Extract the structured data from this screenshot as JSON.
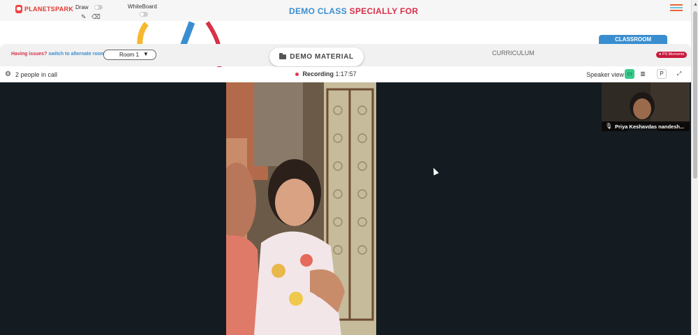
{
  "header": {
    "logo_text": "PLANETSPARK",
    "draw_label": "Draw",
    "whiteboard_label": "WhiteBoard",
    "banner_part1": "DEMO CLASS",
    "banner_part2": "SPECIALLY FOR",
    "accent_blue": "#3a8ed0",
    "accent_red": "#d8304a"
  },
  "tabs": {
    "classroom_label": "CLASSROOM",
    "curriculum_label": "CURRICULUM",
    "demo_material_label": "DEMO MATERIAL"
  },
  "issues": {
    "question": "Having issues?",
    "switch_link": "switch to alternate room"
  },
  "room_select": {
    "value": "Room 1"
  },
  "ps_moments_label": "PS Moments",
  "call": {
    "people_text": "2 people in call",
    "recording_label": "Recording",
    "recording_time": "1:17:57",
    "speaker_view_label": "Speaker view",
    "pin_label": "P"
  },
  "participant": {
    "name": "Priya Keshavdas nandesh..."
  }
}
